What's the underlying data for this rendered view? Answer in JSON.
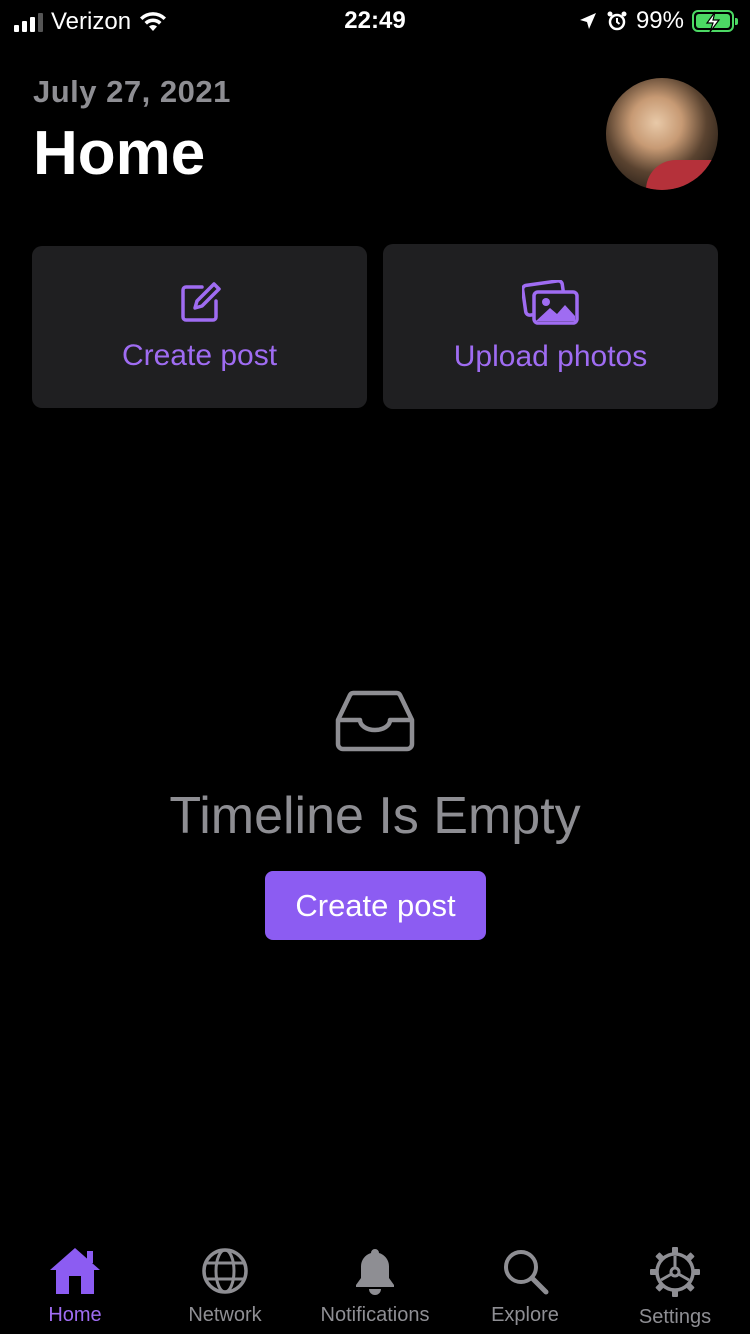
{
  "status_bar": {
    "carrier": "Verizon",
    "time": "22:49",
    "battery_percent": "99%",
    "signal_bars": 3
  },
  "header": {
    "date": "July 27, 2021",
    "title": "Home"
  },
  "actions": {
    "create_post": "Create post",
    "upload_photos": "Upload photos"
  },
  "empty_state": {
    "title": "Timeline Is Empty",
    "button": "Create post"
  },
  "tabs": [
    {
      "label": "Home",
      "icon": "house-icon",
      "active": true
    },
    {
      "label": "Network",
      "icon": "globe-icon",
      "active": false
    },
    {
      "label": "Notifications",
      "icon": "bell-icon",
      "active": false
    },
    {
      "label": "Explore",
      "icon": "magnifier-icon",
      "active": false
    },
    {
      "label": "Settings",
      "icon": "gear-icon",
      "active": false
    }
  ],
  "colors": {
    "accent": "#9f6cf2",
    "button": "#8c5cf2",
    "card": "#1f1f21",
    "muted": "#8e8e93",
    "battery": "#4cd964"
  }
}
